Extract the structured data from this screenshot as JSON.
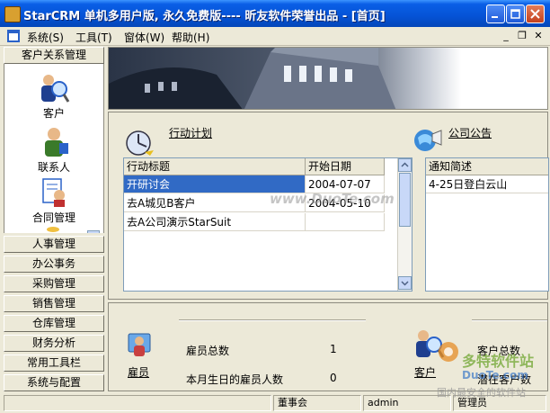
{
  "window": {
    "title": "StarCRM 单机多用户版, 永久免费版---- 昕友软件荣誉出品  - [首页]"
  },
  "menu": {
    "items": [
      "系统(S)",
      "工具(T)",
      "窗体(W)",
      "帮助(H)"
    ]
  },
  "sidebar": {
    "active_group": "客户关系管理",
    "entries": [
      {
        "label": "客户",
        "icon": "customer-search-icon"
      },
      {
        "label": "联系人",
        "icon": "contact-person-icon"
      },
      {
        "label": "合同管理",
        "icon": "contract-icon"
      }
    ],
    "groups": [
      "人事管理",
      "办公事务",
      "采购管理",
      "销售管理",
      "仓库管理",
      "财务分析",
      "常用工具栏",
      "系统与配置"
    ]
  },
  "plan": {
    "title": "行动计划",
    "columns": [
      "行动标题",
      "开始日期"
    ],
    "rows": [
      {
        "title": "开研讨会",
        "date": "2004-07-07"
      },
      {
        "title": "去A城见B客户",
        "date": "2004-05-10"
      },
      {
        "title": "去A公司演示StarSuit",
        "date": ""
      }
    ]
  },
  "notice": {
    "title": "公司公告",
    "columns": [
      "通知简述"
    ],
    "rows": [
      "4-25日登白云山"
    ]
  },
  "summary": {
    "employee_icon_label": "雇员",
    "employee_total_label": "雇员总数",
    "employee_total": "1",
    "birthday_label": "本月生日的雇员人数",
    "birthday_count": "0",
    "customer_icon_label": "客户",
    "customer_total_label": "客户总数",
    "potential_label": "潜在客户数"
  },
  "status": [
    "董事会",
    "admin",
    "管理员"
  ],
  "watermarks": {
    "center": "www.DuoTe.com",
    "corner_brand": "多特软件站",
    "corner_site": "DuoTe.com",
    "corner_slogan": "国内最安全的软件站"
  },
  "colors": {
    "titlebar": "#0553d6",
    "selection": "#316ac5",
    "chrome": "#ece9d8"
  }
}
